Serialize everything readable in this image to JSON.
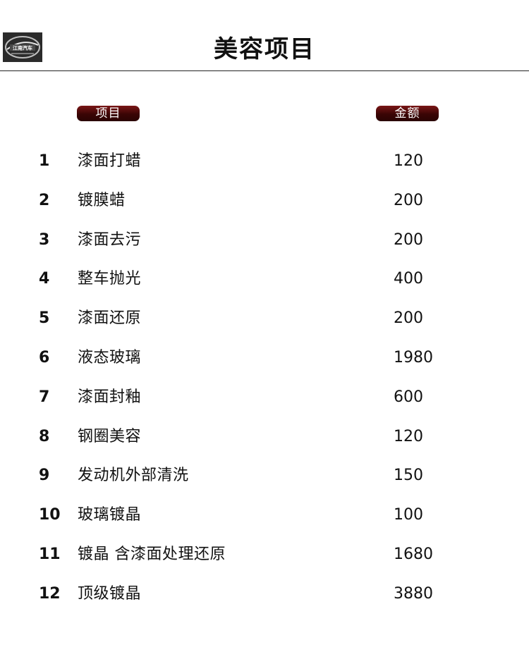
{
  "header": {
    "title": "美容项目",
    "logo_text": "江南汽车"
  },
  "columns": {
    "item_label": "项目",
    "amount_label": "金额"
  },
  "colors": {
    "pill_dark": "#3a0505",
    "pill_light": "#7a1616",
    "text": "#111111"
  },
  "items": [
    {
      "num": "1",
      "name": "漆面打蜡",
      "price": "120"
    },
    {
      "num": "2",
      "name": "镀膜蜡",
      "price": "200"
    },
    {
      "num": "3",
      "name": "漆面去污",
      "price": "200"
    },
    {
      "num": "4",
      "name": "整车抛光",
      "price": "400"
    },
    {
      "num": "5",
      "name": "漆面还原",
      "price": "200"
    },
    {
      "num": "6",
      "name": "液态玻璃",
      "price": "1980"
    },
    {
      "num": "7",
      "name": "漆面封釉",
      "price": "600"
    },
    {
      "num": "8",
      "name": "钢圈美容",
      "price": "120"
    },
    {
      "num": "9",
      "name": "发动机外部清洗",
      "price": "150"
    },
    {
      "num": "10",
      "name": "玻璃镀晶",
      "price": "100"
    },
    {
      "num": "11",
      "name": "镀晶 含漆面处理还原",
      "price": "1680"
    },
    {
      "num": "12",
      "name": "顶级镀晶",
      "price": "3880"
    }
  ]
}
